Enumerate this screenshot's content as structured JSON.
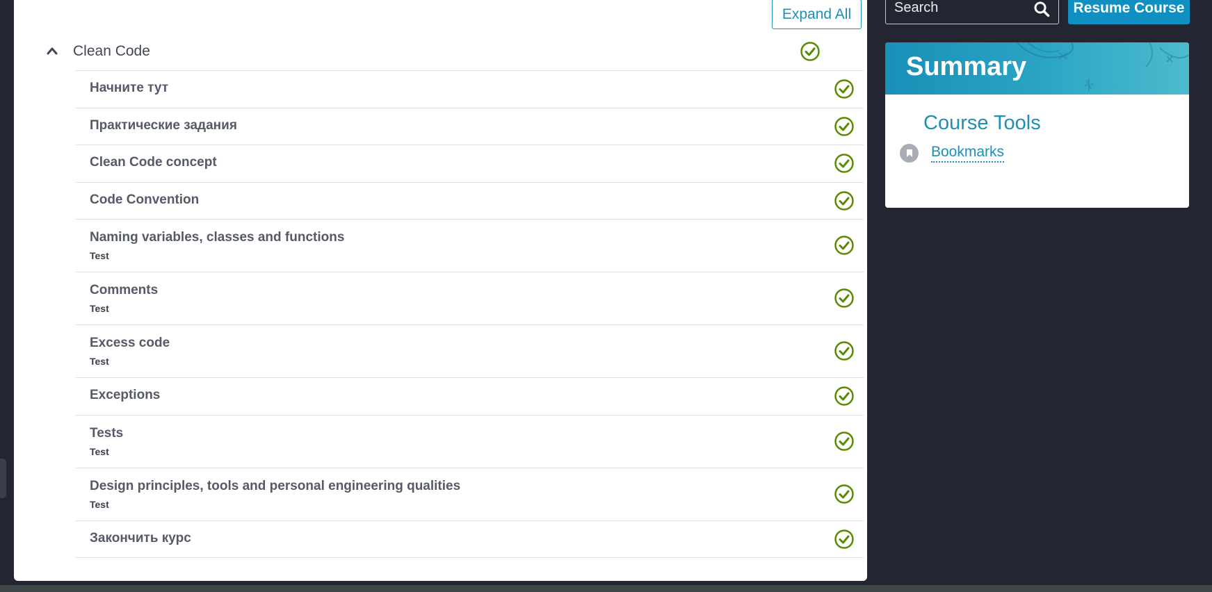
{
  "toolbar": {
    "search_placeholder": "Search",
    "resume_label": "Resume Course"
  },
  "outline": {
    "expand_all_label": "Expand All",
    "section": {
      "title": "Clean Code",
      "expanded": true,
      "completed": true
    },
    "lessons": [
      {
        "title": "Начните тут",
        "subtitle": "",
        "completed": true
      },
      {
        "title": "Практические задания",
        "subtitle": "",
        "completed": true
      },
      {
        "title": "Clean Code concept",
        "subtitle": "",
        "completed": true
      },
      {
        "title": "Code Convention",
        "subtitle": "",
        "completed": true
      },
      {
        "title": "Naming variables, classes and functions",
        "subtitle": "Test",
        "completed": true
      },
      {
        "title": "Comments",
        "subtitle": "Test",
        "completed": true
      },
      {
        "title": "Excess code",
        "subtitle": "Test",
        "completed": true
      },
      {
        "title": "Exceptions",
        "subtitle": "",
        "completed": true
      },
      {
        "title": "Tests",
        "subtitle": "Test",
        "completed": true
      },
      {
        "title": "Design principles, tools and personal engineering qualities",
        "subtitle": "Test",
        "completed": true
      },
      {
        "title": "Закончить курс",
        "subtitle": "",
        "completed": true
      }
    ]
  },
  "summary": {
    "title": "Summary",
    "tools_heading": "Course Tools",
    "bookmarks_label": "Bookmarks"
  },
  "colors": {
    "page_bg": "#232631",
    "accent": "#1d8fb8",
    "complete_green": "#5a8a00",
    "text": "#555a66"
  },
  "icons": {
    "check": "check-circle-icon",
    "chevron": "chevron-up-icon",
    "search": "search-icon",
    "bookmark": "bookmark-icon"
  }
}
